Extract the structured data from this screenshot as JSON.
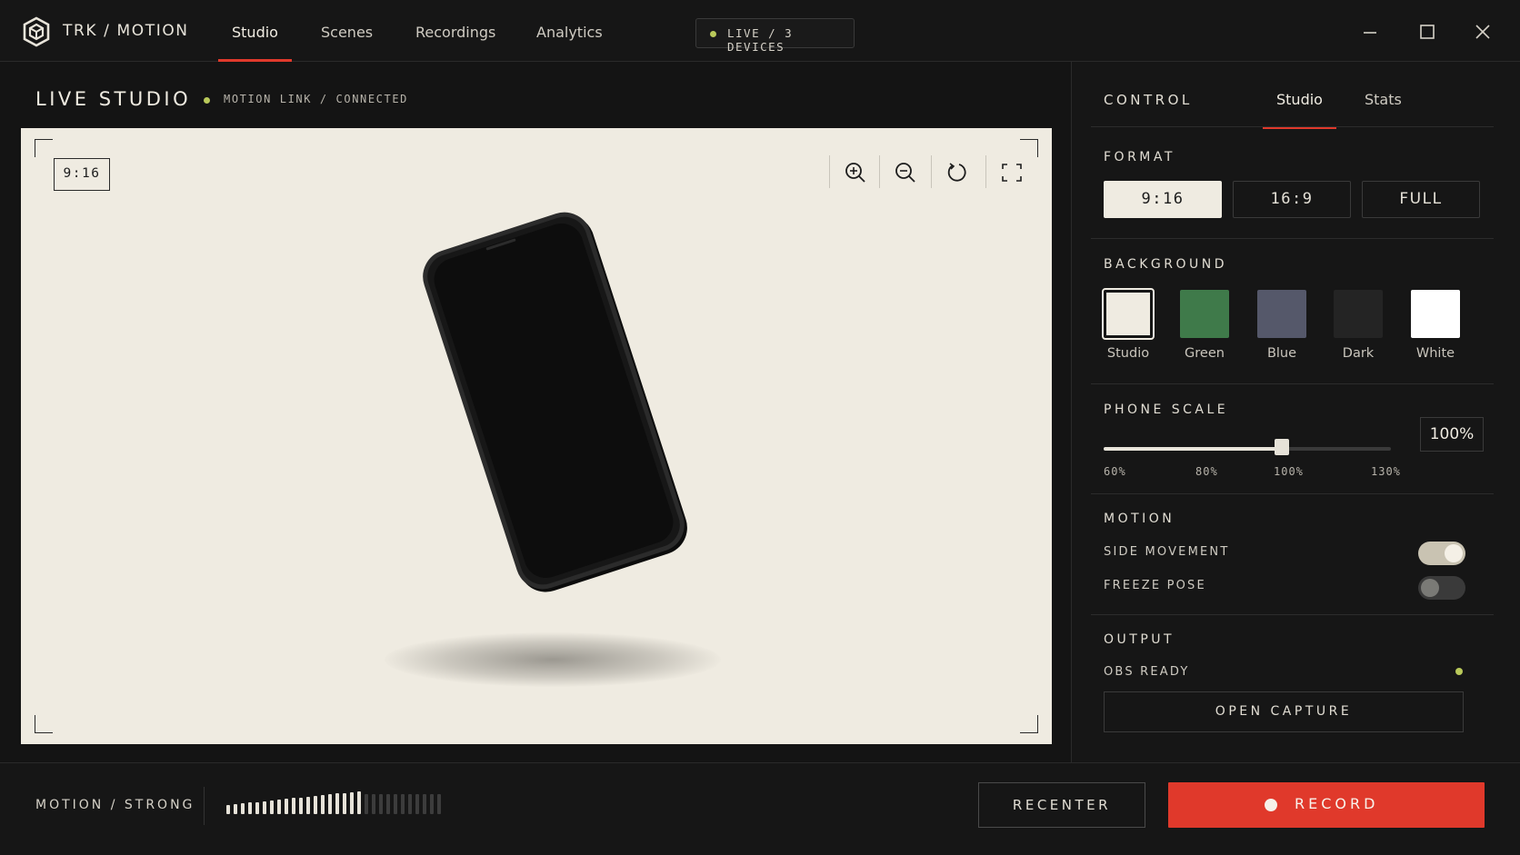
{
  "app": {
    "brand": "TRK / MOTION"
  },
  "nav": {
    "tabs": [
      {
        "label": "Studio",
        "active": true
      },
      {
        "label": "Scenes",
        "active": false
      },
      {
        "label": "Recordings",
        "active": false
      },
      {
        "label": "Analytics",
        "active": false
      }
    ],
    "live_status": "LIVE / 3 DEVICES"
  },
  "stage": {
    "title": "LIVE STUDIO",
    "link_status": "MOTION LINK / CONNECTED",
    "ratio_badge": "9:16",
    "tools": [
      "zoom-in-icon",
      "zoom-out-icon",
      "rotate-icon",
      "fullscreen-icon"
    ]
  },
  "panel": {
    "title": "CONTROL",
    "tabs": [
      {
        "label": "Studio",
        "active": true
      },
      {
        "label": "Stats",
        "active": false
      }
    ],
    "format": {
      "label": "FORMAT",
      "options": [
        {
          "label": "9:16",
          "selected": true
        },
        {
          "label": "16:9",
          "selected": false
        },
        {
          "label": "FULL",
          "selected": false
        }
      ]
    },
    "background": {
      "label": "BACKGROUND",
      "swatches": [
        {
          "label": "Studio",
          "color": "#efebe1",
          "selected": true
        },
        {
          "label": "Green",
          "color": "#3f7a4a",
          "selected": false
        },
        {
          "label": "Blue",
          "color": "#55586a",
          "selected": false
        },
        {
          "label": "Dark",
          "color": "#242424",
          "selected": false
        },
        {
          "label": "White",
          "color": "#ffffff",
          "selected": false
        }
      ]
    },
    "phone_scale": {
      "label": "PHONE SCALE",
      "value": "100%",
      "value_fraction": 0.62,
      "ticks": [
        "60%",
        "80%",
        "100%",
        "130%"
      ]
    },
    "motion": {
      "label": "MOTION",
      "side_movement": {
        "label": "SIDE MOVEMENT",
        "on": true
      },
      "freeze_pose": {
        "label": "FREEZE POSE",
        "on": false
      }
    },
    "output": {
      "label": "OUTPUT",
      "status": "OBS READY",
      "open_capture": "OPEN CAPTURE"
    }
  },
  "bottom": {
    "motion_level": "MOTION / STRONG",
    "meter_active_fraction": 0.63,
    "recenter": "RECENTER",
    "record": "RECORD"
  },
  "colors": {
    "accent": "#e0392b",
    "status_ok": "#b9c95a",
    "studio_bg": "#efebe1"
  }
}
